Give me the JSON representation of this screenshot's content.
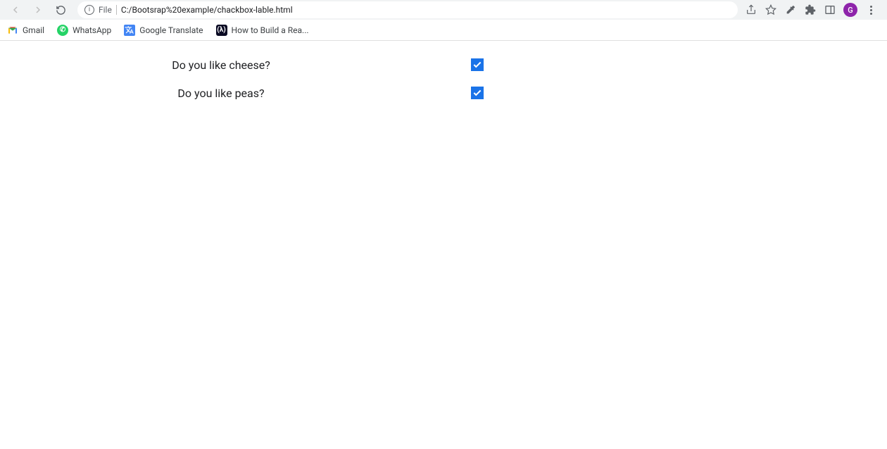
{
  "browser": {
    "address": {
      "prefix": "File",
      "url": "C:/Bootsrap%20example/chackbox-lable.html"
    },
    "avatar_letter": "G"
  },
  "bookmarks": [
    {
      "label": "Gmail"
    },
    {
      "label": "WhatsApp"
    },
    {
      "label": "Google Translate"
    },
    {
      "label": "How to Build a Rea..."
    }
  ],
  "form": {
    "rows": [
      {
        "label": "Do you like cheese?",
        "checked": true
      },
      {
        "label": "Do you like peas?",
        "checked": true
      }
    ]
  }
}
